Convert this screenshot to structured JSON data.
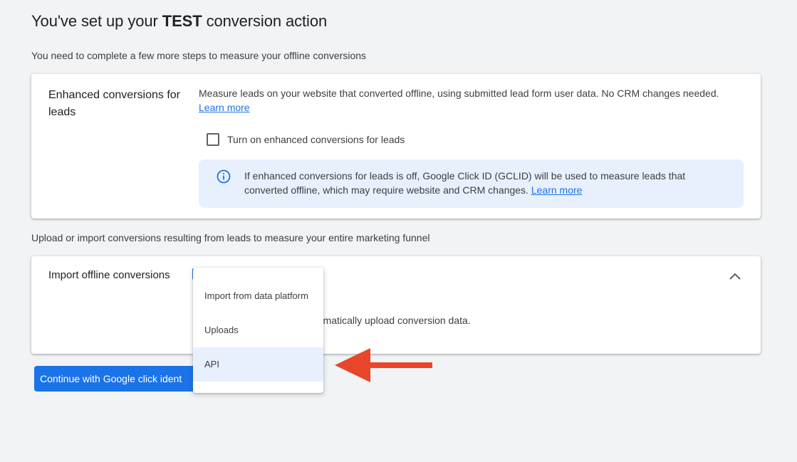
{
  "header": {
    "title_prefix": "You've set up your ",
    "title_emphasis": "TEST",
    "title_suffix": " conversion action",
    "subtitle": "You need to complete a few more steps to measure your offline conversions"
  },
  "enhanced_card": {
    "heading": "Enhanced conversions for leads",
    "description": "Measure leads on your website that converted offline, using submitted lead form user data. No CRM changes needed.",
    "learn_more": "Learn more",
    "checkbox_label": "Turn on enhanced conversions for leads",
    "checkbox_checked": false,
    "info_text": "If enhanced conversions for leads is off, Google Click ID (GCLID) will be used to measure leads that converted offline, which may require website and CRM changes.",
    "info_learn_more": "Learn more",
    "info_icon": "info-icon"
  },
  "upload_section": {
    "subtitle": "Upload or import conversions resulting from leads to measure your entire marketing funnel"
  },
  "import_card": {
    "heading": "Import offline conversions",
    "description_visible": "mmatically upload conversion data.",
    "collapse_icon": "chevron-up-icon"
  },
  "dropdown": {
    "items": [
      {
        "label": "Import from data platform",
        "selected": false
      },
      {
        "label": "Uploads",
        "selected": false
      },
      {
        "label": "API",
        "selected": true
      }
    ]
  },
  "continue_button": {
    "label": "Continue with Google click ident"
  },
  "colors": {
    "primary": "#1a73e8",
    "info_bg": "#e8f0fe",
    "arrow": "#e8462a",
    "page_bg": "#f1f3f4"
  }
}
